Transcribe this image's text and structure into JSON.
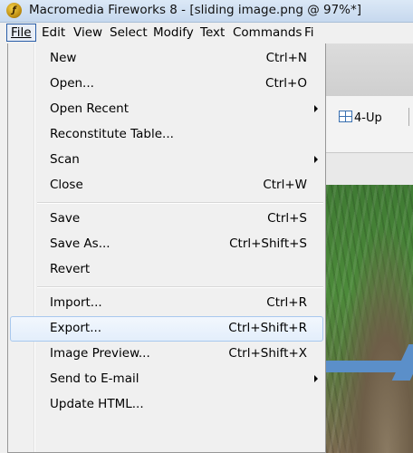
{
  "window": {
    "title": "Macromedia Fireworks 8 - [sliding image.png @ 97%*]",
    "logo_glyph": "ƒ"
  },
  "menubar": {
    "items": [
      {
        "label": "File"
      },
      {
        "label": "Edit"
      },
      {
        "label": "View"
      },
      {
        "label": "Select"
      },
      {
        "label": "Modify"
      },
      {
        "label": "Text"
      },
      {
        "label": "Commands"
      },
      {
        "label": "Fi"
      }
    ]
  },
  "toolbar": {
    "view_4up": "4-Up"
  },
  "file_menu": {
    "items": [
      {
        "label": "New",
        "shortcut": "Ctrl+N"
      },
      {
        "label": "Open...",
        "shortcut": "Ctrl+O"
      },
      {
        "label": "Open Recent",
        "shortcut": "",
        "submenu": true
      },
      {
        "label": "Reconstitute Table...",
        "shortcut": ""
      },
      {
        "label": "Scan",
        "shortcut": "",
        "submenu": true
      },
      {
        "label": "Close",
        "shortcut": "Ctrl+W"
      },
      {
        "label": "Save",
        "shortcut": "Ctrl+S"
      },
      {
        "label": "Save As...",
        "shortcut": "Ctrl+Shift+S"
      },
      {
        "label": "Revert",
        "shortcut": ""
      },
      {
        "label": "Import...",
        "shortcut": "Ctrl+R"
      },
      {
        "label": "Export...",
        "shortcut": "Ctrl+Shift+R",
        "highlighted": true
      },
      {
        "label": "Image Preview...",
        "shortcut": "Ctrl+Shift+X"
      },
      {
        "label": "Send to E-mail",
        "shortcut": "",
        "submenu": true
      },
      {
        "label": "Update HTML...",
        "shortcut": ""
      }
    ]
  },
  "colors": {
    "highlight_border": "#a8c8ee",
    "callout_arrow": "#5b8fc9"
  }
}
